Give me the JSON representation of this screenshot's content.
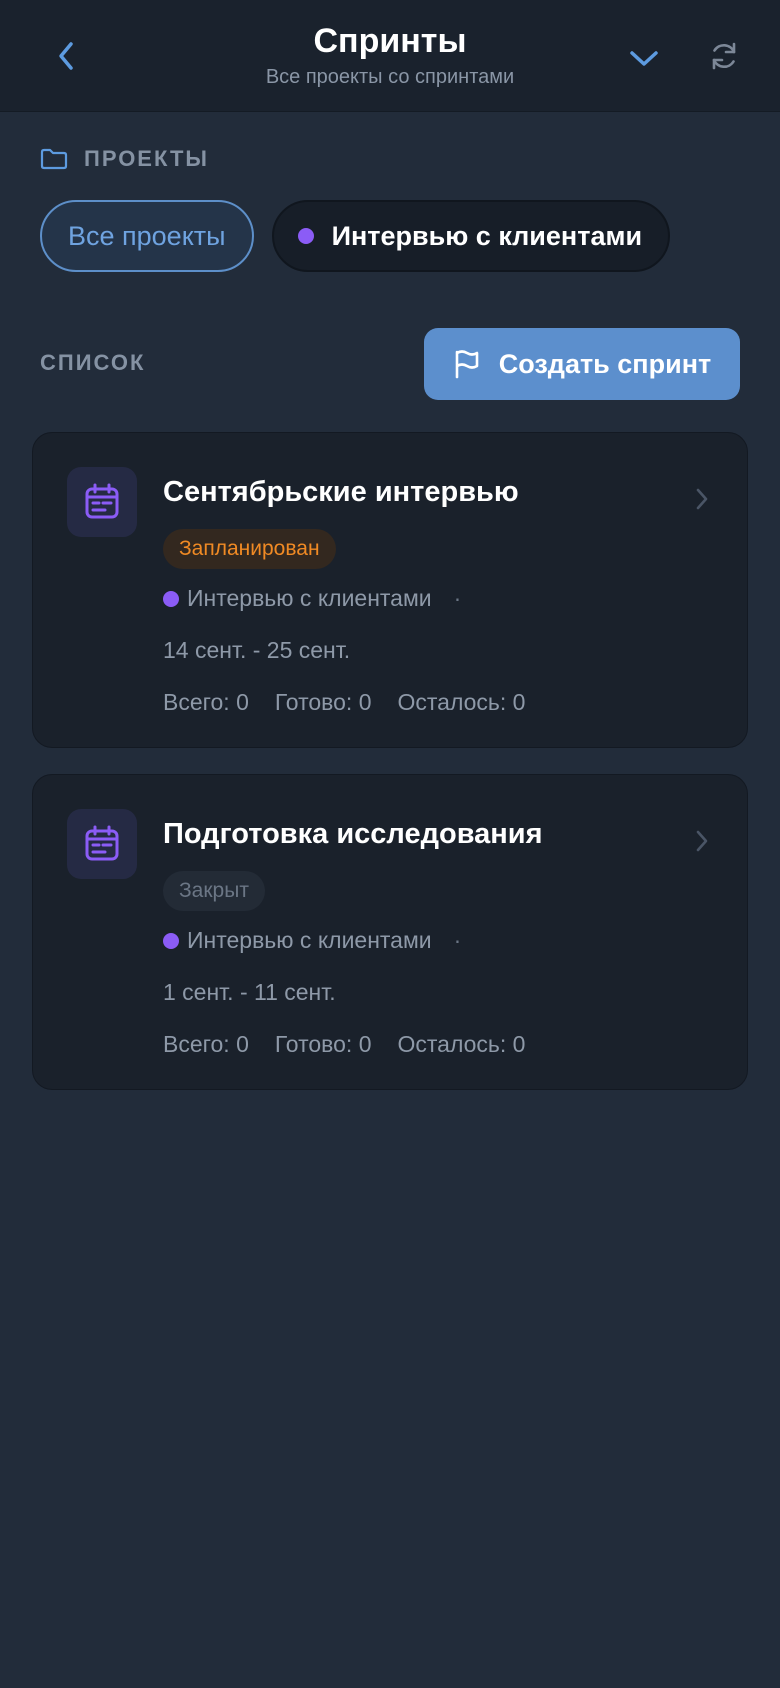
{
  "header": {
    "title": "Спринты",
    "subtitle": "Все проекты со спринтами",
    "back_icon": "chevron-left-icon",
    "dropdown_icon": "chevron-down-icon",
    "refresh_icon": "refresh-icon"
  },
  "projects_section": {
    "label": "ПРОЕКТЫ",
    "icon": "folder-icon",
    "chips": [
      {
        "label": "Все проекты",
        "active": true
      },
      {
        "label": "Интервью с клиентами",
        "active": false,
        "dot_color": "#8b5cf6"
      }
    ]
  },
  "list_section": {
    "label": "СПИСОК",
    "create_button_label": "Создать спринт",
    "create_button_icon": "flag-icon"
  },
  "sprints": [
    {
      "name": "Сентябрьские интервью",
      "status": "Запланирован",
      "status_color": "#f08a24",
      "project": "Интервью с клиентами",
      "separator": "·",
      "dates": "14 сент. - 25 сент.",
      "total": "Всего: 0",
      "done": "Готово: 0",
      "remaining": "Осталось: 0"
    },
    {
      "name": "Подготовка исследования",
      "status": "Закрыт",
      "status_color": "#6b7685",
      "project": "Интервью с клиентами",
      "separator": "·",
      "dates": "1 сент. - 11 сент.",
      "total": "Всего: 0",
      "done": "Готово: 0",
      "remaining": "Осталось: 0"
    }
  ],
  "colors": {
    "background": "#222c3a",
    "header": "#1a222d",
    "accent": "#5c8fcd",
    "project_dot": "#8b5cf6"
  }
}
